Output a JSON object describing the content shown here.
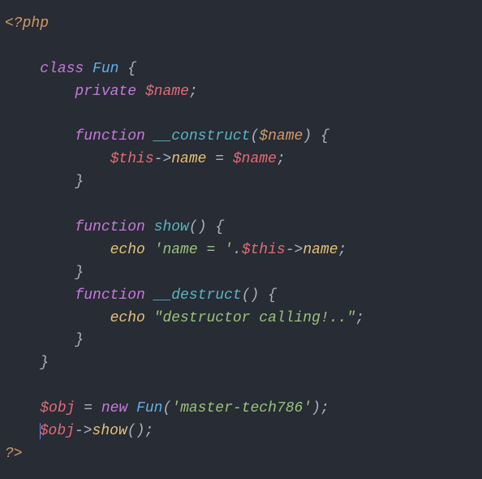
{
  "tokens": {
    "open": "<?php",
    "close": "?>",
    "kw_class": "class",
    "cls_name": "Fun",
    "brace_o": "{",
    "brace_c": "}",
    "kw_private": "private",
    "var_name": "$name",
    "semi": ";",
    "kw_function": "function",
    "fn_construct": "__construct",
    "paren_o": "(",
    "paren_c": ")",
    "param_name": "$name",
    "var_this": "$this",
    "arrow": "->",
    "prop_name": "name",
    "op_eq": " = ",
    "fn_show": "show",
    "kw_echo": "echo",
    "str_nameeq": "'name = '",
    "op_concat": ".",
    "fn_destruct": "__destruct",
    "str_destruct": "\"destructor calling!..\"",
    "var_obj": "$obj",
    "kw_new": "new",
    "str_master": "'master-tech786'",
    "call_show": "show"
  }
}
